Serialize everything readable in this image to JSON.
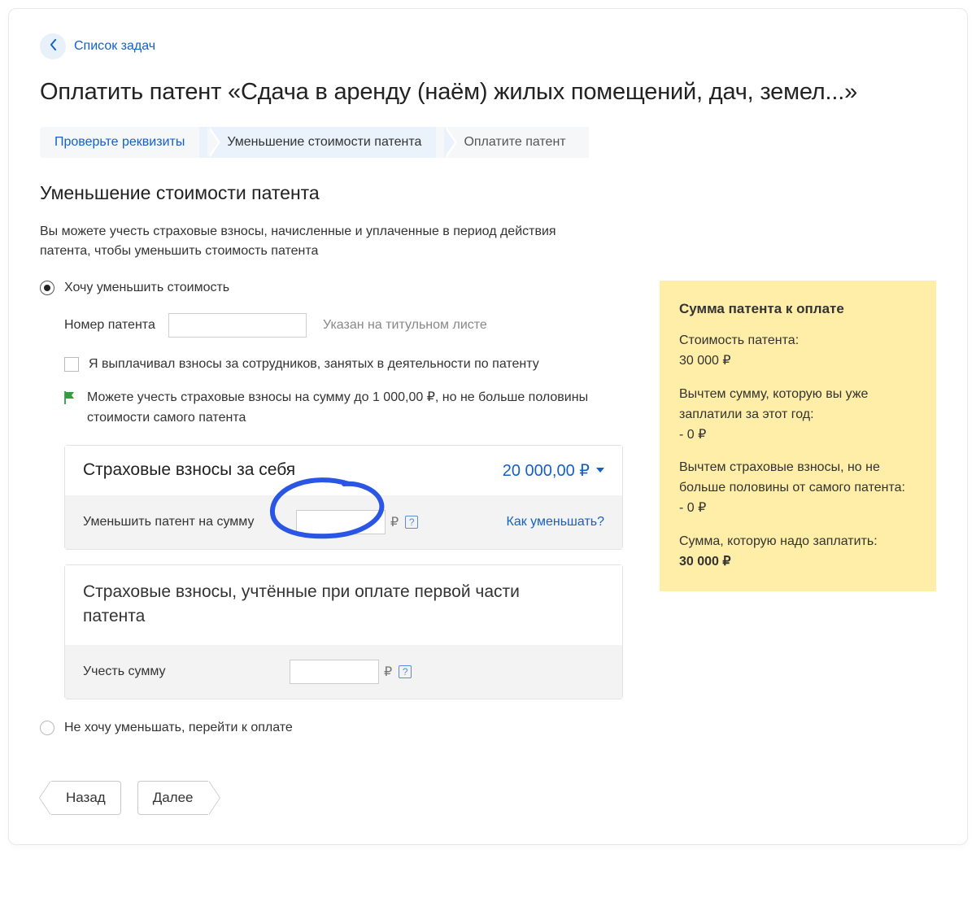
{
  "back_link": "Список задач",
  "page_title": "Оплатить патент «Сдача в аренду (наём) жилых помещений, дач, земел...»",
  "breadcrumb": {
    "items": [
      {
        "label": "Проверьте реквизиты",
        "state": "completed"
      },
      {
        "label": "Уменьшение стоимости патента",
        "state": "active"
      },
      {
        "label": "Оплатите патент",
        "state": ""
      }
    ]
  },
  "section_title": "Уменьшение стоимости патента",
  "section_desc": "Вы можете учесть страховые взносы, начисленные и уплаченные в период действия патента, чтобы уменьшить стоимость патента",
  "radio": {
    "reduce_label": "Хочу уменьшить стоимость",
    "skip_label": "Не хочу уменьшать, перейти к оплате"
  },
  "patent_number": {
    "label": "Номер патента",
    "value": "",
    "hint": "Указан на титульном листе"
  },
  "employees_checkbox": "Я выплачивал взносы за сотрудников, занятых в деятельности по патенту",
  "flag_note": "Можете учесть страховые взносы на сумму до 1 000,00 ₽, но не больше половины стоимости самого патента",
  "panel1": {
    "title": "Страховые взносы за себя",
    "amount": "20 000,00 ₽",
    "field_label": "Уменьшить патент на сумму",
    "value": "",
    "how_link": "Как уменьшать?"
  },
  "panel2": {
    "title": "Страховые взносы, учтённые при оплате первой части патента",
    "field_label": "Учесть сумму",
    "value": ""
  },
  "summary": {
    "title": "Сумма патента к оплате",
    "cost_label": "Стоимость патента:",
    "cost_value": "30 000 ₽",
    "paid_label": "Вычтем сумму, которую вы уже заплатили за этот год:",
    "paid_value": "- 0 ₽",
    "insurance_label": "Вычтем страховые взносы, но не больше половины от самого патента:",
    "insurance_value": "- 0 ₽",
    "total_label": "Сумма, которую надо заплатить:",
    "total_value": "30 000 ₽"
  },
  "buttons": {
    "back": "Назад",
    "next": "Далее"
  },
  "glyphs": {
    "ruble": "₽",
    "question": "?"
  }
}
